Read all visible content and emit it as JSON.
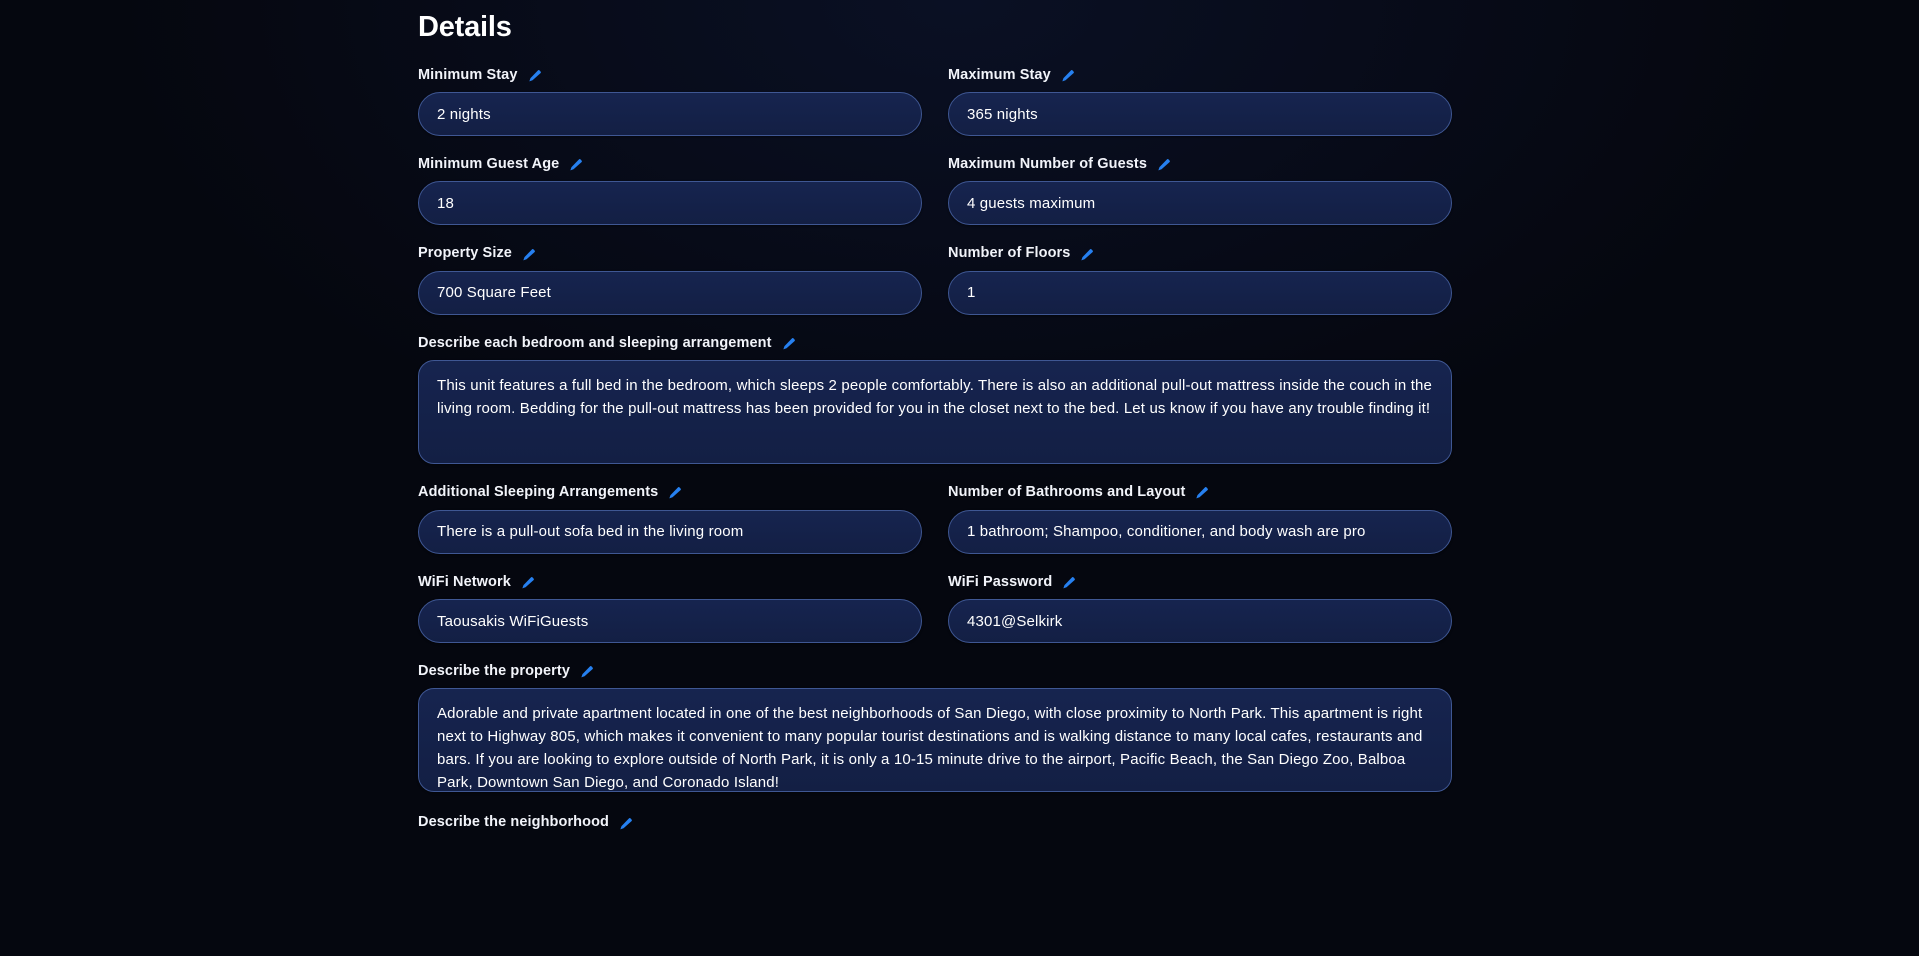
{
  "page": {
    "title": "Details",
    "accent_color": "#2680f0",
    "background_color": "#05070f",
    "field_background_color": "#16244f",
    "field_border_color": "#3f5793",
    "text_color": "#ffffff",
    "edit_icon": "pencil-icon"
  },
  "fields": {
    "minimum_stay": {
      "label": "Minimum Stay",
      "value": "2 nights"
    },
    "maximum_stay": {
      "label": "Maximum Stay",
      "value": "365 nights"
    },
    "minimum_guest_age": {
      "label": "Minimum Guest Age",
      "value": "18"
    },
    "maximum_number_of_guests": {
      "label": "Maximum Number of Guests",
      "value": "4 guests maximum"
    },
    "property_size": {
      "label": "Property Size",
      "value": "700 Square Feet"
    },
    "number_of_floors": {
      "label": "Number of Floors",
      "value": "1"
    },
    "bedroom_description": {
      "label": "Describe each bedroom and sleeping arrangement",
      "value": "This unit features a full bed in the bedroom, which sleeps 2 people comfortably. There is also an additional pull-out mattress inside the couch in the living room. Bedding for the pull-out mattress has been provided for you in the closet next to the bed. Let us know if you have any trouble finding it!"
    },
    "additional_sleeping_arrangements": {
      "label": "Additional Sleeping Arrangements",
      "value": "There is a pull-out sofa bed in the living room"
    },
    "bathrooms_and_layout": {
      "label": "Number of Bathrooms and Layout",
      "value": "1 bathroom; Shampoo, conditioner, and body wash are pro"
    },
    "wifi_network": {
      "label": "WiFi Network",
      "value": "Taousakis WiFiGuests"
    },
    "wifi_password": {
      "label": "WiFi Password",
      "value": "4301@Selkirk"
    },
    "property_description": {
      "label": "Describe the property",
      "value": "Adorable and private apartment located in one of the best neighborhoods of San Diego, with close proximity to North Park. This apartment is right next to Highway 805, which makes it convenient to many popular tourist destinations and is walking distance to many local cafes, restaurants and bars. If you are looking to explore outside of North Park, it is only a 10-15 minute drive to the airport, Pacific Beach, the San Diego Zoo, Balboa Park, Downtown San Diego, and Coronado Island!"
    },
    "neighborhood_description": {
      "label": "Describe the neighborhood"
    }
  }
}
